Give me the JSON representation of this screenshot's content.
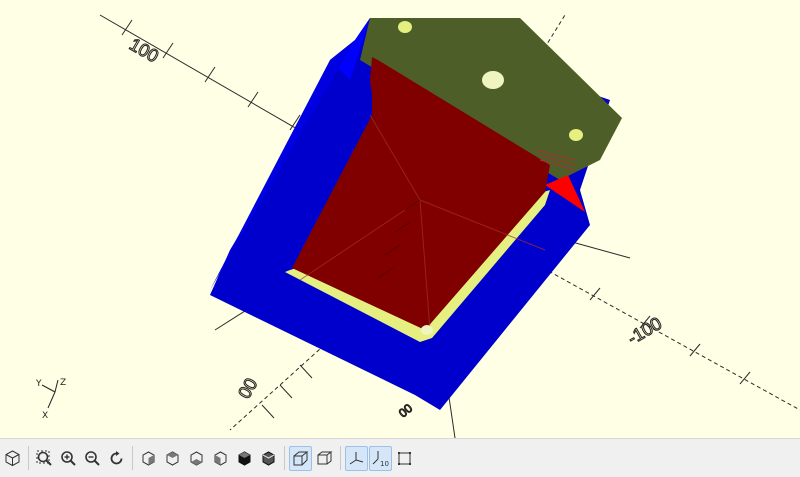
{
  "viewport": {
    "axis_labels": {
      "y_positive": "100",
      "x_negative": "-100",
      "y_negative": "-100",
      "z_small": "00"
    },
    "gizmo": {
      "z": "Z",
      "y": "Y",
      "x": "X"
    },
    "colors": {
      "background": "#ffffe5",
      "front_face": "#0000cc",
      "top_face": "#4e5e28",
      "cut_face": "#800000",
      "highlight": "#ff0000",
      "rim": "#e6f080"
    }
  },
  "toolbar": {
    "buttons": [
      {
        "name": "view-all-icon",
        "active": false
      },
      {
        "name": "zoom-all-icon",
        "active": false
      },
      {
        "name": "zoom-in-icon",
        "active": false
      },
      {
        "name": "zoom-out-icon",
        "active": false
      },
      {
        "name": "reset-view-icon",
        "active": false
      },
      {
        "name": "view-right-icon",
        "active": false
      },
      {
        "name": "view-top-icon",
        "active": false
      },
      {
        "name": "view-bottom-icon",
        "active": false
      },
      {
        "name": "view-left-icon",
        "active": false
      },
      {
        "name": "view-front-icon",
        "active": false
      },
      {
        "name": "view-back-icon",
        "active": false
      },
      {
        "name": "perspective-icon",
        "active": true
      },
      {
        "name": "orthogonal-icon",
        "active": false
      },
      {
        "name": "show-axes-icon",
        "active": true
      },
      {
        "name": "show-scale-markers-icon",
        "active": true
      },
      {
        "name": "show-edges-icon",
        "active": false
      }
    ],
    "scale_marker_text": "10"
  }
}
